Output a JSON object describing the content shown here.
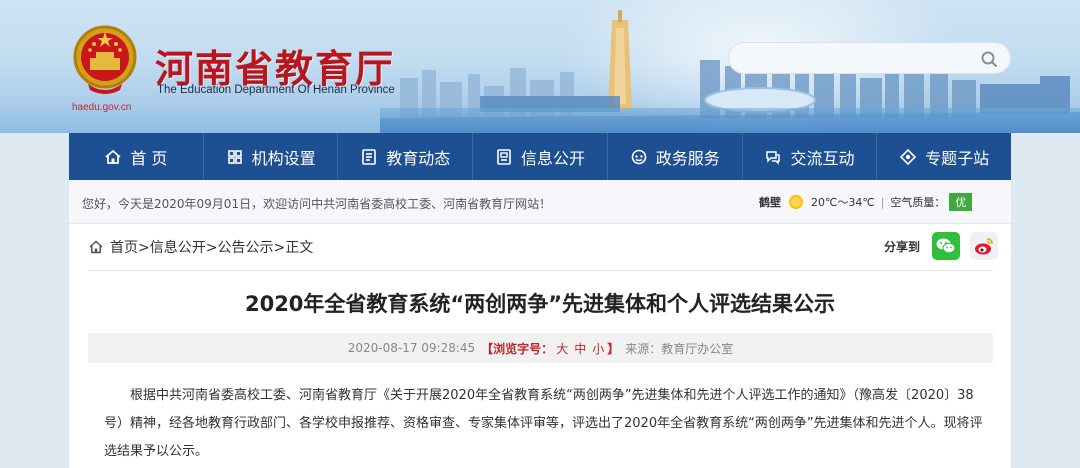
{
  "header": {
    "site_title": "河南省教育厅",
    "site_subtitle": "The Education Department Of Henan Province",
    "site_url": "haedu.gov.cn",
    "search_placeholder": ""
  },
  "nav": {
    "items": [
      {
        "label": "首 页",
        "icon": "home-icon"
      },
      {
        "label": "机构设置",
        "icon": "org-icon"
      },
      {
        "label": "教育动态",
        "icon": "news-icon"
      },
      {
        "label": "信息公开",
        "icon": "info-icon"
      },
      {
        "label": "政务服务",
        "icon": "service-icon"
      },
      {
        "label": "交流互动",
        "icon": "interact-icon"
      },
      {
        "label": "专题子站",
        "icon": "topic-icon"
      }
    ]
  },
  "welcome": {
    "text": "您好，今天是2020年09月01日，欢迎访问中共河南省委高校工委、河南省教育厅网站！",
    "weather": {
      "city": "鹤壁",
      "temperature": "20℃～34℃",
      "aqi_label": "空气质量：",
      "aqi_value": "优",
      "aqi_color": "#3fa93f"
    }
  },
  "breadcrumb": {
    "home": "首页",
    "level1": ">信息公开",
    "level2": ">公告公示",
    "level3": ">正文"
  },
  "share": {
    "label": "分享到"
  },
  "article": {
    "title": "2020年全省教育系统“两创两争”先进集体和个人评选结果公示",
    "datetime": "2020-08-17 09:28:45",
    "font_size_prefix": "【浏览字号：",
    "font_large": "大",
    "font_medium": "中",
    "font_small": "小",
    "font_size_suffix": "】",
    "source": "来源：教育厅办公室",
    "paragraph": "根据中共河南省委高校工委、河南省教育厅《关于开展2020年全省教育系统“两创两争”先进集体和先进个人评选工作的通知》（豫高发〔2020〕38号）精神，经各地教育行政部门、各学校申报推荐、资格审查、专家集体评审等，评选出了2020年全省教育系统“两创两争”先进集体和先进个人。现将评选结果予以公示。"
  },
  "colors": {
    "brand_red": "#b8161d",
    "nav_blue": "#1d4f93"
  }
}
